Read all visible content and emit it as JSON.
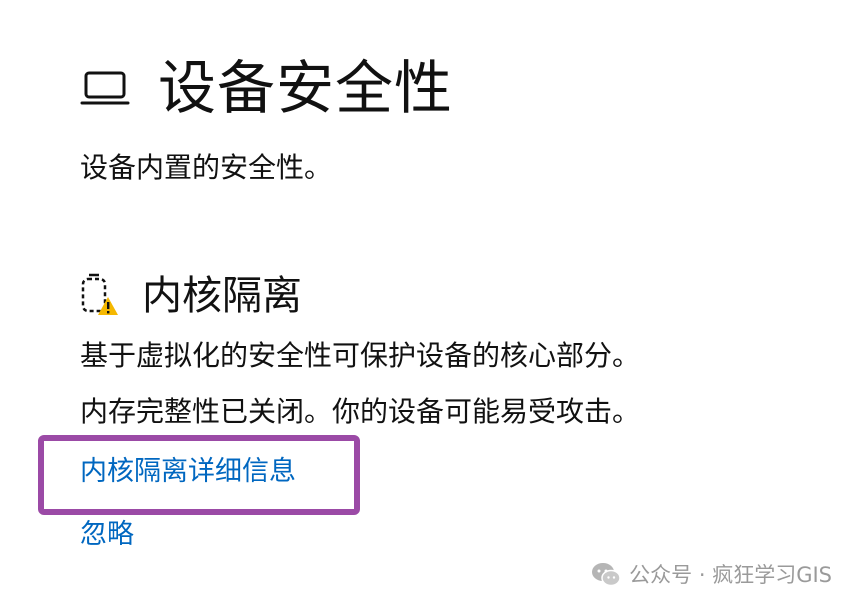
{
  "header": {
    "icon": "laptop-icon",
    "title": "设备安全性"
  },
  "page_description": "设备内置的安全性。",
  "core_isolation": {
    "icon": "core-isolation-warning-icon",
    "title": "内核隔离",
    "description": "基于虚拟化的安全性可保护设备的核心部分。",
    "status": "内存完整性已关闭。你的设备可能易受攻击。",
    "details_link": "内核隔离详细信息",
    "ignore_link": "忽略"
  },
  "watermark": {
    "icon": "wechat-icon",
    "text": "公众号 · 疯狂学习GIS"
  },
  "colors": {
    "link": "#0067c0",
    "highlight": "#9b4aa6",
    "warning": "#f5b800"
  }
}
